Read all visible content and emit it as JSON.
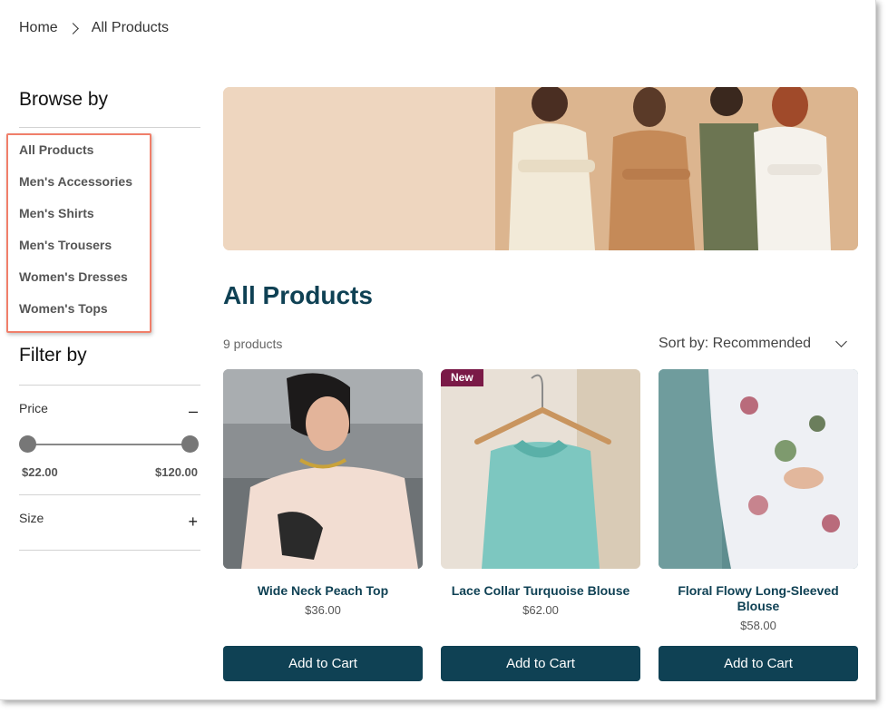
{
  "breadcrumb": {
    "home": "Home",
    "current": "All Products"
  },
  "sidebar": {
    "browse_title": "Browse by",
    "categories": [
      "All Products",
      "Men's Accessories",
      "Men's Shirts",
      "Men's Trousers",
      "Women's Dresses",
      "Women's Tops"
    ],
    "filter_title": "Filter by",
    "price": {
      "label": "Price",
      "min": "$22.00",
      "max": "$120.00",
      "toggle": "–"
    },
    "size": {
      "label": "Size",
      "toggle": "+"
    }
  },
  "main": {
    "title": "All Products",
    "count": "9 products",
    "sort_label": "Sort by: Recommended",
    "products": [
      {
        "name": "Wide Neck Peach Top",
        "price": "$36.00",
        "badge": "",
        "button": "Add to Cart"
      },
      {
        "name": "Lace Collar Turquoise Blouse",
        "price": "$62.00",
        "badge": "New",
        "button": "Add to Cart"
      },
      {
        "name": "Floral Flowy Long-Sleeved Blouse",
        "price": "$58.00",
        "badge": "",
        "button": "Add to Cart"
      }
    ]
  },
  "colors": {
    "primary": "#0f4154",
    "badge": "#7a1a47",
    "highlight": "#f07f6a"
  }
}
